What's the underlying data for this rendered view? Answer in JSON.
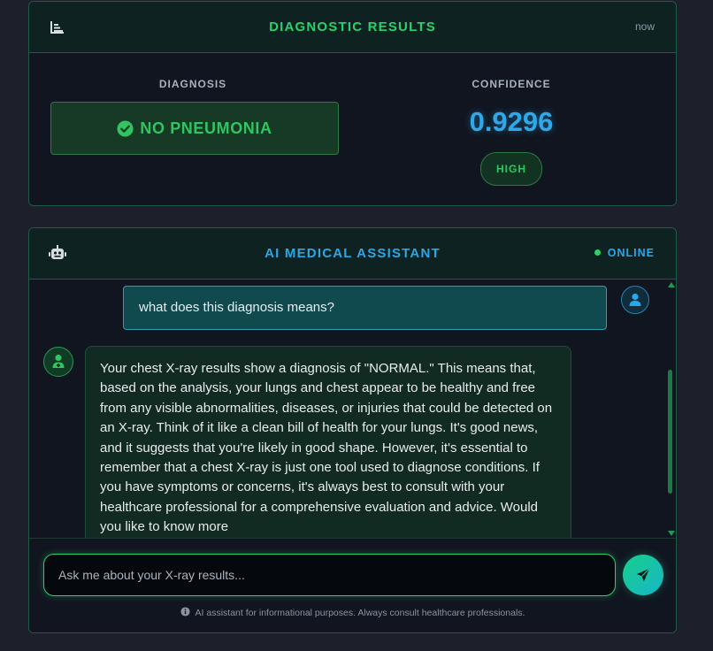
{
  "results": {
    "title": "DIAGNOSTIC RESULTS",
    "time": "now",
    "icon": "chart-icon",
    "diagnosis_label": "DIAGNOSIS",
    "diagnosis_value": "NO PNEUMONIA",
    "diagnosis_icon": "check-circle-icon",
    "confidence_label": "CONFIDENCE",
    "confidence_value": "0.9296",
    "confidence_level": "HIGH"
  },
  "assistant": {
    "title": "AI MEDICAL ASSISTANT",
    "icon": "robot-icon",
    "status": "ONLINE",
    "messages": [
      {
        "role": "user",
        "text": "what does this diagnosis means?"
      },
      {
        "role": "assistant",
        "text": "Your chest X-ray results show a diagnosis of \"NORMAL.\" This means that, based on the analysis, your lungs and chest appear to be healthy and free from any visible abnormalities, diseases, or injuries that could be detected on an X-ray. Think of it like a clean bill of health for your lungs. It's good news, and it suggests that you're likely in good shape. However, it's essential to remember that a chest X-ray is just one tool used to diagnose conditions. If you have symptoms or concerns, it's always best to consult with your healthcare professional for a comprehensive evaluation and advice. Would you like to know more"
      }
    ],
    "input_placeholder": "Ask me about your X-ray results...",
    "input_value": "",
    "send_icon": "send-icon",
    "disclaimer": "AI assistant for informational purposes. Always consult healthcare professionals."
  },
  "colors": {
    "background": "#1d202b",
    "panel": "#111520",
    "accent_green": "#25d36a",
    "accent_blue": "#2aa7e6",
    "border": "#1f5a45"
  }
}
